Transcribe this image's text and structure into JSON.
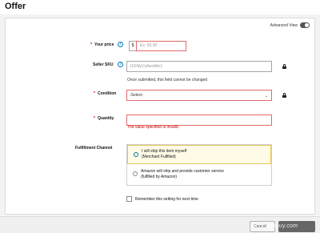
{
  "page": {
    "title": "Offer"
  },
  "advanced_view": {
    "label": "Advanced View",
    "enabled": true
  },
  "form": {
    "price": {
      "label": "Your price",
      "required_mark": "*",
      "currency": "$",
      "placeholder": "Ex: 50.00"
    },
    "sku": {
      "label": "Seller SKU",
      "placeholder": "101MyCollectible1",
      "note": "Once submitted, this field cannot be changed"
    },
    "condition": {
      "label": "Condition",
      "required_mark": "*",
      "value": "-Select-"
    },
    "quantity": {
      "label": "Quantity",
      "required_mark": "*",
      "error": "The value specified is invalid."
    },
    "fulfillment": {
      "label": "Fulfillment Channel",
      "options": [
        {
          "line1": "I will ship this item myself",
          "line2": "(Merchant Fulfilled)",
          "selected": true
        },
        {
          "line1": "Amazon will ship and provide customer service",
          "line2": "(fulfilled by Amazon)",
          "selected": false
        }
      ]
    },
    "remember": {
      "label": "Remember this setting for next time",
      "checked": false
    }
  },
  "footer": {
    "cancel_label": "Cancel",
    "watermark": "www.ugabuy.com"
  },
  "colors": {
    "error": "#c40000",
    "accent": "#007185",
    "help": "#007eb9"
  }
}
